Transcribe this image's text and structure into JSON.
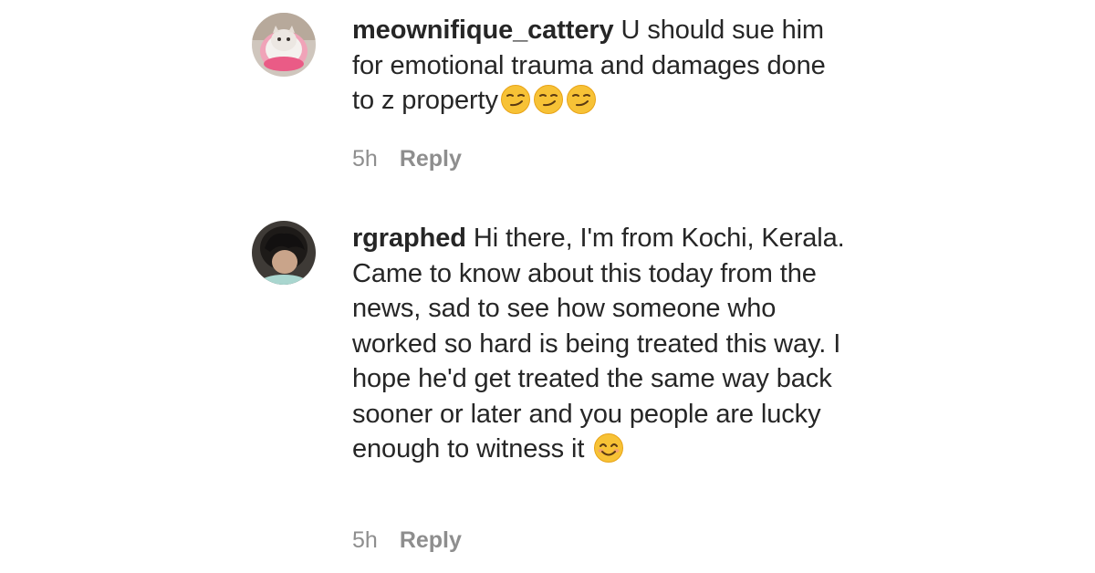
{
  "comments": [
    {
      "username": "meownifique_cattery",
      "text": " U should sue him for emotional trauma and damages done to z property",
      "emojis": [
        "smirking-face",
        "smirking-face",
        "smirking-face"
      ],
      "time": "5h",
      "reply_label": "Reply"
    },
    {
      "username": "rgraphed",
      "text": " Hi there, I'm from Kochi, Kerala. Came to know about this today from the news, sad to see how someone who worked so hard is being treated this way. I hope he'd get treated the same way back sooner or later and you people are lucky enough to witness it ",
      "emojis": [
        "smiling-face-with-smiling-eyes"
      ],
      "time": "5h",
      "reply_label": "Reply"
    }
  ],
  "colors": {
    "text": "#262626",
    "meta": "#8e8e8e",
    "background": "#ffffff",
    "emoji_yellow": "#f7c236",
    "emoji_outline": "#e8a317"
  }
}
